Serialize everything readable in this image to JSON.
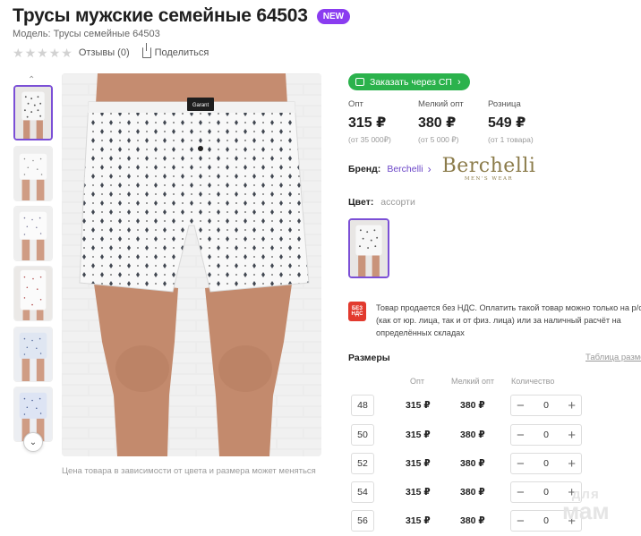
{
  "product": {
    "title": "Трусы мужские семейные 64503",
    "badge": "NEW",
    "model_text": "Модель: Трусы семейные 64503",
    "rating_stars": 0,
    "reviews_text": "Отзывы (0)",
    "share_label": "Поделиться"
  },
  "gallery": {
    "note": "Цена товара в зависимости от цвета и размера может меняться",
    "active_thumb": 0
  },
  "order_button": "Заказать через СП",
  "prices": [
    {
      "label": "Опт",
      "value": "315 ₽",
      "min": "(от 35 000₽)"
    },
    {
      "label": "Мелкий опт",
      "value": "380 ₽",
      "min": "(от 5 000 ₽)"
    },
    {
      "label": "Розница",
      "value": "549 ₽",
      "min": "(от 1 товара)"
    }
  ],
  "brand": {
    "label": "Бренд:",
    "name": "Berchelli",
    "logo_main": "Berchelli",
    "logo_sub": "MEN'S WEAR"
  },
  "color": {
    "label": "Цвет:",
    "value": "ассорти"
  },
  "vat": {
    "badge_line1": "БЕЗ",
    "badge_line2": "НДС",
    "text": "Товар продается без НДС. Оплатить такой товар можно только на р/с (как от юр. лица, так и от физ. лица) или за наличный расчёт на определённых складах"
  },
  "sizes": {
    "title": "Размеры",
    "table_link": "Таблица размеров",
    "col_opt": "Опт",
    "col_small": "Мелкий опт",
    "col_qty": "Количество",
    "rows": [
      {
        "size": "48",
        "opt": "315 ₽",
        "small": "380 ₽",
        "qty": "0"
      },
      {
        "size": "50",
        "opt": "315 ₽",
        "small": "380 ₽",
        "qty": "0"
      },
      {
        "size": "52",
        "opt": "315 ₽",
        "small": "380 ₽",
        "qty": "0"
      },
      {
        "size": "54",
        "opt": "315 ₽",
        "small": "380 ₽",
        "qty": "0"
      },
      {
        "size": "56",
        "opt": "315 ₽",
        "small": "380 ₽",
        "qty": "0"
      }
    ]
  },
  "watermark": {
    "line1": "для",
    "line2": "мам"
  },
  "colors": {
    "accent_purple": "#7b4fd6",
    "badge_purple": "#8a3cf0",
    "green_button": "#2bb24c",
    "vat_red": "#e23a2e",
    "brand_gold": "#8b7b4a"
  }
}
